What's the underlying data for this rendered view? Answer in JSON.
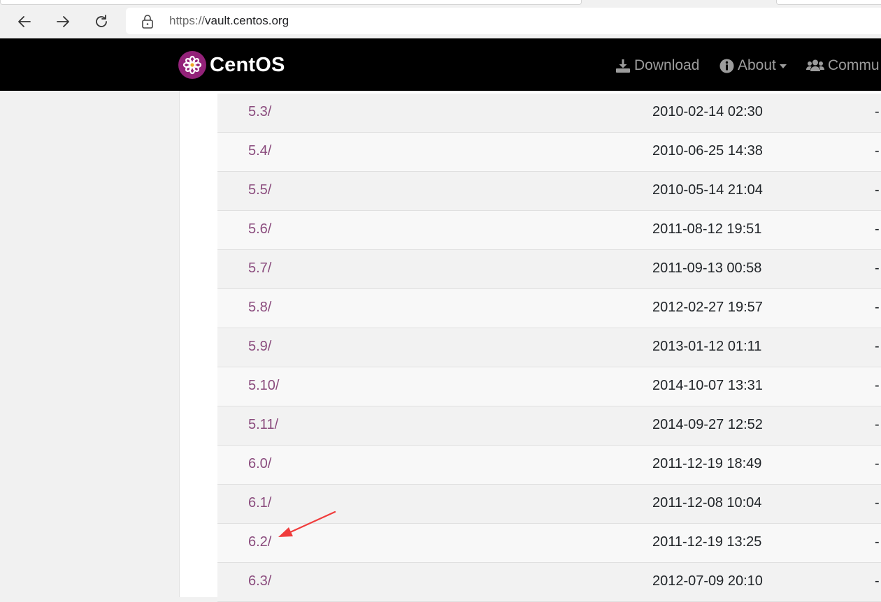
{
  "browser": {
    "url_scheme": "https://",
    "url_host": "vault.centos.org"
  },
  "header": {
    "brand": "CentOS",
    "nav": [
      {
        "label": "Download",
        "icon": "download-icon"
      },
      {
        "label": "About",
        "icon": "info-circle-icon"
      },
      {
        "label": "Commu",
        "icon": "users-icon"
      }
    ]
  },
  "listing": {
    "rows": [
      {
        "name": "5.3/",
        "modified": "2010-02-14 02:30",
        "size": "-"
      },
      {
        "name": "5.4/",
        "modified": "2010-06-25 14:38",
        "size": "-"
      },
      {
        "name": "5.5/",
        "modified": "2010-05-14 21:04",
        "size": "-"
      },
      {
        "name": "5.6/",
        "modified": "2011-08-12 19:51",
        "size": "-"
      },
      {
        "name": "5.7/",
        "modified": "2011-09-13 00:58",
        "size": "-"
      },
      {
        "name": "5.8/",
        "modified": "2012-02-27 19:57",
        "size": "-"
      },
      {
        "name": "5.9/",
        "modified": "2013-01-12 01:11",
        "size": "-"
      },
      {
        "name": "5.10/",
        "modified": "2014-10-07 13:31",
        "size": "-"
      },
      {
        "name": "5.11/",
        "modified": "2014-09-27 12:52",
        "size": "-"
      },
      {
        "name": "6.0/",
        "modified": "2011-12-19 18:49",
        "size": "-"
      },
      {
        "name": "6.1/",
        "modified": "2011-12-08 10:04",
        "size": "-"
      },
      {
        "name": "6.2/",
        "modified": "2011-12-19 13:25",
        "size": "-"
      },
      {
        "name": "6.3/",
        "modified": "2012-07-09 20:10",
        "size": "-"
      }
    ]
  },
  "colors": {
    "link": "#8a4b7d",
    "header_bg": "#000000",
    "brand_purple": "#932279",
    "annotation_arrow": "#f03c3c"
  }
}
